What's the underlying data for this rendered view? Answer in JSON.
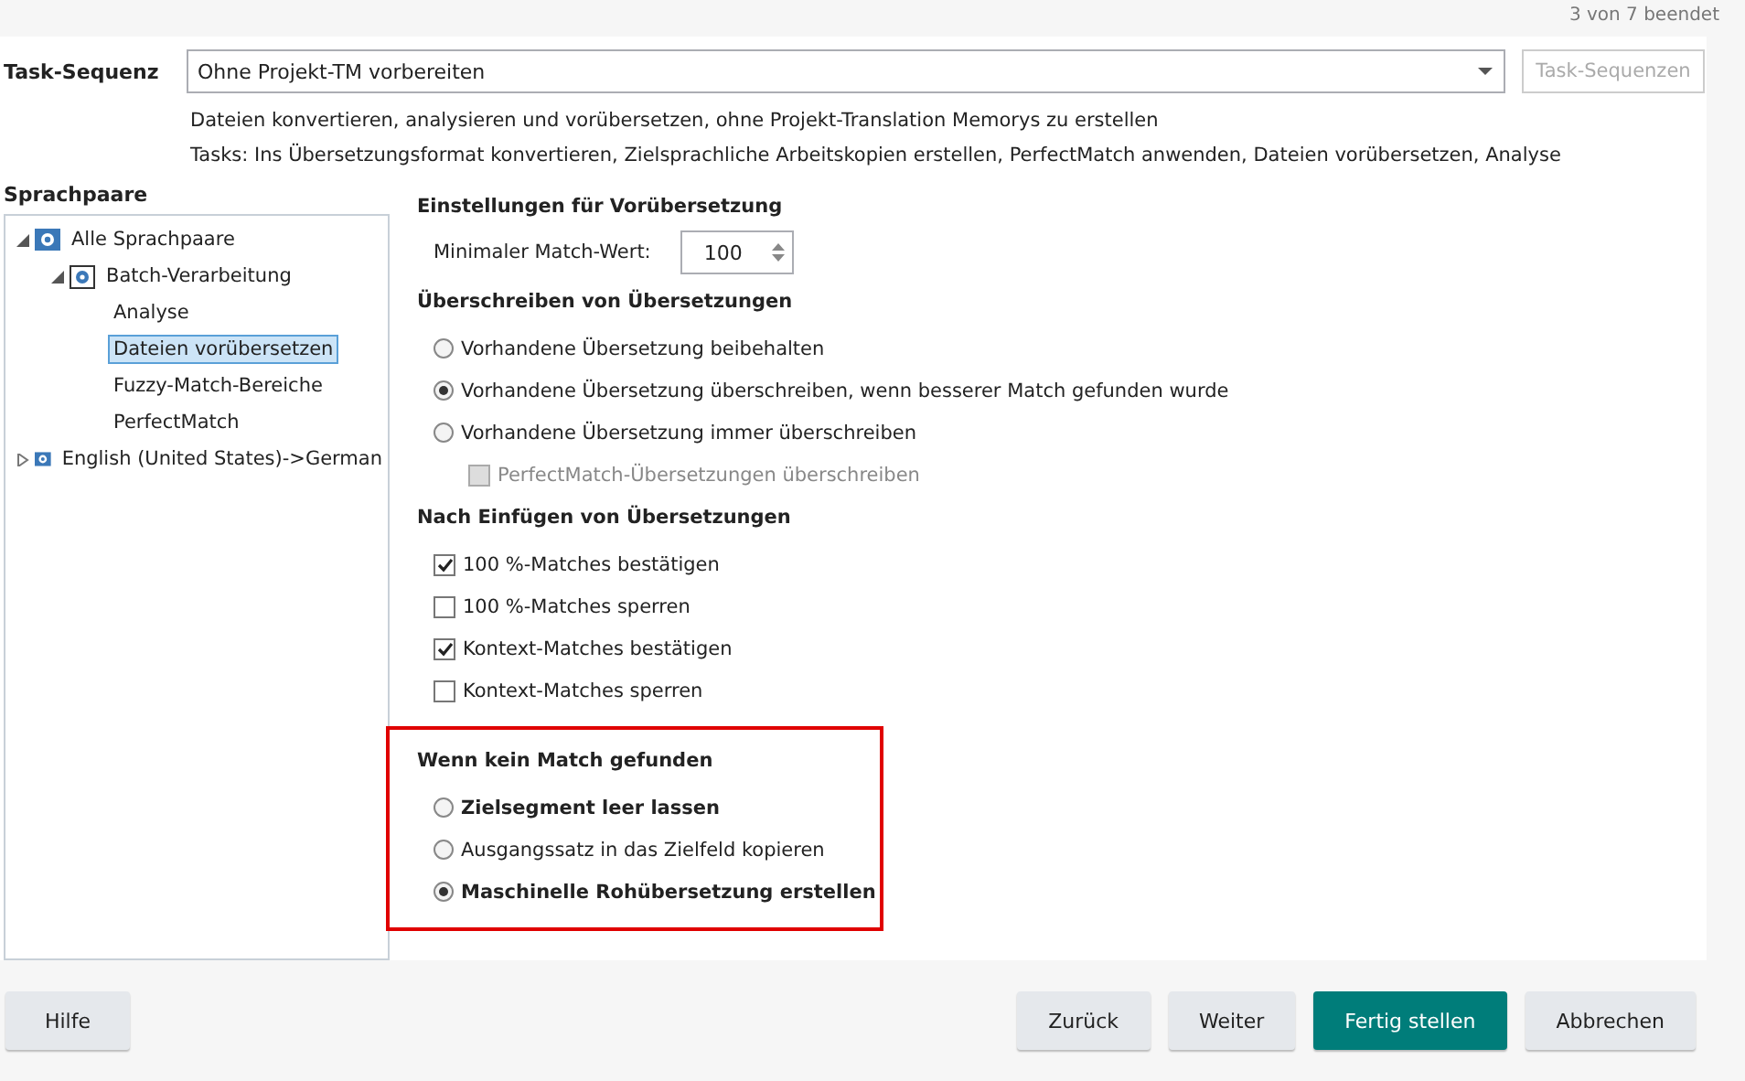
{
  "progress": "3 von 7 beendet",
  "task_sequence": {
    "label": "Task-Sequenz",
    "value": "Ohne Projekt-TM vorbereiten",
    "button": {
      "label": "Task-Sequenzen",
      "disabled": true
    },
    "description": "Dateien konvertieren, analysieren und vorübersetzen, ohne Projekt-Translation Memorys zu erstellen",
    "tasks": "Tasks: Ins Übersetzungsformat konvertieren, Zielsprachliche Arbeitskopien erstellen, PerfectMatch anwenden, Dateien vorübersetzen, Analyse"
  },
  "language_pairs": {
    "title": "Sprachpaare",
    "tree": [
      {
        "label": "Alle Sprachpaare",
        "kind": "globe",
        "expanded": true,
        "selected": false,
        "children": [
          {
            "label": "Batch-Verarbeitung",
            "kind": "gear",
            "expanded": true,
            "selected": false,
            "children": [
              {
                "label": "Analyse",
                "kind": "leaf",
                "selected": false
              },
              {
                "label": "Dateien vorübersetzen",
                "kind": "leaf",
                "selected": true
              },
              {
                "label": "Fuzzy-Match-Bereiche",
                "kind": "leaf",
                "selected": false
              },
              {
                "label": "PerfectMatch",
                "kind": "leaf",
                "selected": false
              }
            ]
          }
        ]
      },
      {
        "label": "English (United States)->German",
        "kind": "globe",
        "expanded": false,
        "selected": false
      }
    ]
  },
  "sections": [
    {
      "title": "Einstellungen für Vorübersetzung",
      "items": [
        {
          "kind": "spinner",
          "label": "Minimaler Match-Wert:",
          "value": "100"
        }
      ]
    },
    {
      "title": "Überschreiben von Übersetzungen",
      "items": [
        {
          "kind": "radio",
          "label": "Vorhandene Übersetzung beibehalten",
          "selected": false,
          "bold": false
        },
        {
          "kind": "radio",
          "label": "Vorhandene Übersetzung überschreiben, wenn besserer Match gefunden wurde",
          "selected": true,
          "bold": false
        },
        {
          "kind": "radio",
          "label": "Vorhandene Übersetzung immer überschreiben",
          "selected": false,
          "bold": false
        },
        {
          "kind": "subcheckbox",
          "label": "PerfectMatch-Übersetzungen überschreiben",
          "checked": false,
          "disabled": true
        }
      ]
    },
    {
      "title": "Nach Einfügen von Übersetzungen",
      "items": [
        {
          "kind": "checkbox",
          "label": "100 %-Matches bestätigen",
          "checked": true,
          "disabled": false
        },
        {
          "kind": "checkbox",
          "label": "100 %-Matches sperren",
          "checked": false,
          "disabled": false
        },
        {
          "kind": "checkbox",
          "label": "Kontext-Matches bestätigen",
          "checked": true,
          "disabled": false
        },
        {
          "kind": "checkbox",
          "label": "Kontext-Matches sperren",
          "checked": false,
          "disabled": false
        }
      ]
    },
    {
      "title": "Wenn kein Match gefunden",
      "highlighted": true,
      "items": [
        {
          "kind": "radio",
          "label": "Zielsegment leer lassen",
          "selected": false,
          "bold": true
        },
        {
          "kind": "radio",
          "label": "Ausgangssatz in das Zielfeld kopieren",
          "selected": false,
          "bold": false
        },
        {
          "kind": "radio",
          "label": "Maschinelle Rohübersetzung erstellen",
          "selected": true,
          "bold": true
        }
      ]
    }
  ],
  "buttons": [
    {
      "label": "Hilfe",
      "kind": "left",
      "primary": false
    },
    {
      "label": "Zurück",
      "kind": "right",
      "primary": false
    },
    {
      "label": "Weiter",
      "kind": "right",
      "primary": false
    },
    {
      "label": "Fertig stellen",
      "kind": "right",
      "primary": true
    },
    {
      "label": "Abbrechen",
      "kind": "right",
      "primary": false
    }
  ]
}
